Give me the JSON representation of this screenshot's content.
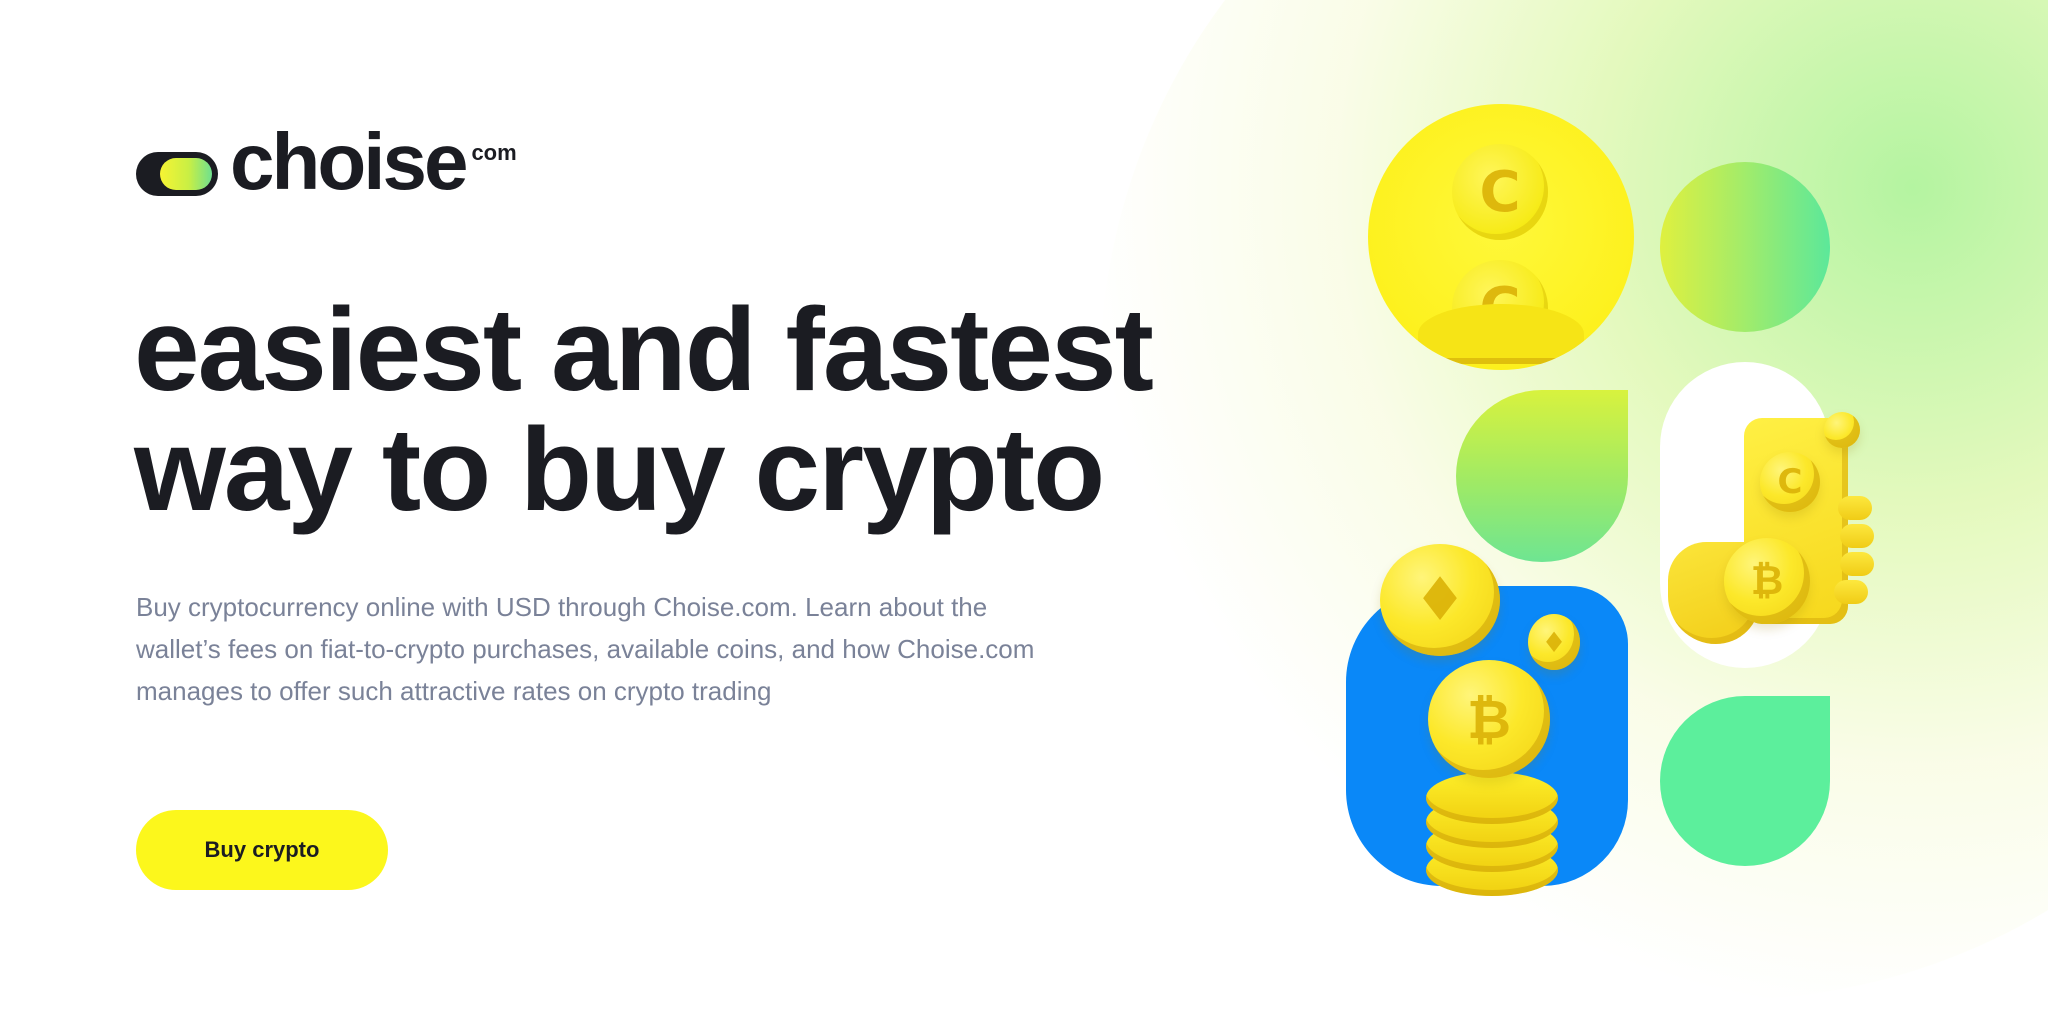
{
  "brand": {
    "name": "choise",
    "suffix": "com"
  },
  "hero": {
    "headline_line1": "easiest and fastest",
    "headline_line2": "way to buy crypto",
    "description": "Buy cryptocurrency online with USD through Choise.com. Learn about the wallet’s fees on fiat-to-crypto purchases, available coins, and how Choise.com manages to offer such attractive rates on crypto trading",
    "cta_label": "Buy crypto"
  },
  "colors": {
    "text_dark": "#1b1c22",
    "text_muted": "#7a8298",
    "accent_yellow": "#fcf71c",
    "accent_blue": "#0a88f8",
    "accent_mint": "#5cef9c",
    "accent_green": "#a8ec66"
  },
  "illustration": {
    "coin_symbol_c": "C",
    "coin_symbol_btc": "₿",
    "coin_symbol_eth": "♦"
  }
}
